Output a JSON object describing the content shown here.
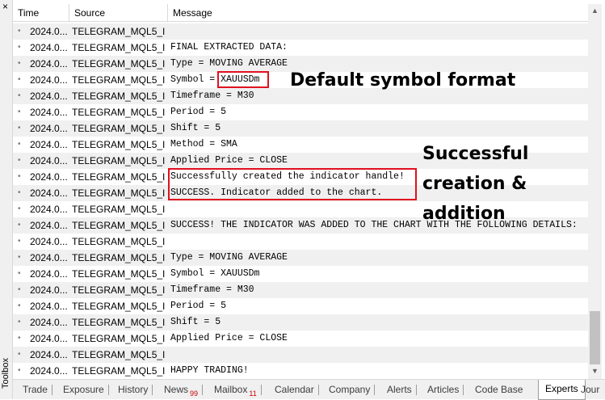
{
  "toolbox": {
    "close": "×",
    "label": "Toolbox"
  },
  "columns": {
    "time": "Time",
    "source": "Source",
    "message": "Message"
  },
  "rows": [
    {
      "time": "2024.0...",
      "source": "TELEGRAM_MQL5_I...",
      "message": ""
    },
    {
      "time": "2024.0...",
      "source": "TELEGRAM_MQL5_I...",
      "message": "FINAL EXTRACTED DATA:"
    },
    {
      "time": "2024.0...",
      "source": "TELEGRAM_MQL5_I...",
      "message": "Type = MOVING AVERAGE"
    },
    {
      "time": "2024.0...",
      "source": "TELEGRAM_MQL5_I...",
      "message": "Symbol = XAUUSDm"
    },
    {
      "time": "2024.0...",
      "source": "TELEGRAM_MQL5_I...",
      "message": "Timeframe = M30"
    },
    {
      "time": "2024.0...",
      "source": "TELEGRAM_MQL5_I...",
      "message": "Period = 5"
    },
    {
      "time": "2024.0...",
      "source": "TELEGRAM_MQL5_I...",
      "message": "Shift = 5"
    },
    {
      "time": "2024.0...",
      "source": "TELEGRAM_MQL5_I...",
      "message": "Method = SMA"
    },
    {
      "time": "2024.0...",
      "source": "TELEGRAM_MQL5_I...",
      "message": "Applied Price = CLOSE"
    },
    {
      "time": "2024.0...",
      "source": "TELEGRAM_MQL5_I...",
      "message": "Successfully created the indicator handle!"
    },
    {
      "time": "2024.0...",
      "source": "TELEGRAM_MQL5_I...",
      "message": "SUCCESS. Indicator added to the chart."
    },
    {
      "time": "2024.0...",
      "source": "TELEGRAM_MQL5_I...",
      "message": ""
    },
    {
      "time": "2024.0...",
      "source": "TELEGRAM_MQL5_I...",
      "message": "SUCCESS! THE INDICATOR WAS ADDED TO THE CHART WITH THE FOLLOWING DETAILS:"
    },
    {
      "time": "2024.0...",
      "source": "TELEGRAM_MQL5_I...",
      "message": ""
    },
    {
      "time": "2024.0...",
      "source": "TELEGRAM_MQL5_I...",
      "message": "Type = MOVING AVERAGE"
    },
    {
      "time": "2024.0...",
      "source": "TELEGRAM_MQL5_I...",
      "message": "Symbol = XAUUSDm"
    },
    {
      "time": "2024.0...",
      "source": "TELEGRAM_MQL5_I...",
      "message": "Timeframe = M30"
    },
    {
      "time": "2024.0...",
      "source": "TELEGRAM_MQL5_I...",
      "message": "Period = 5"
    },
    {
      "time": "2024.0...",
      "source": "TELEGRAM_MQL5_I...",
      "message": "Shift = 5"
    },
    {
      "time": "2024.0...",
      "source": "TELEGRAM_MQL5_I...",
      "message": "Applied Price = CLOSE"
    },
    {
      "time": "2024.0...",
      "source": "TELEGRAM_MQL5_I...",
      "message": ""
    },
    {
      "time": "2024.0...",
      "source": "TELEGRAM_MQL5_I...",
      "message": "HAPPY TRADING!"
    }
  ],
  "tabs": [
    {
      "label": "Trade"
    },
    {
      "label": "Exposure"
    },
    {
      "label": "History"
    },
    {
      "label": "News",
      "badge": "99"
    },
    {
      "label": "Mailbox",
      "badge": "11"
    },
    {
      "label": "Calendar"
    },
    {
      "label": "Company"
    },
    {
      "label": "Alerts"
    },
    {
      "label": "Articles"
    },
    {
      "label": "Code Base"
    },
    {
      "label": "Experts",
      "active": true
    },
    {
      "label": "Jour"
    }
  ],
  "annotations": {
    "symbol": "Default symbol format",
    "success": [
      "Successful",
      "creation &",
      "addition"
    ]
  },
  "colors": {
    "highlight_box": "#e01020",
    "alt_row": "#f0f0f0"
  },
  "icons": {
    "bullet": "•",
    "scroll_up": "▲",
    "scroll_down": "▼"
  }
}
